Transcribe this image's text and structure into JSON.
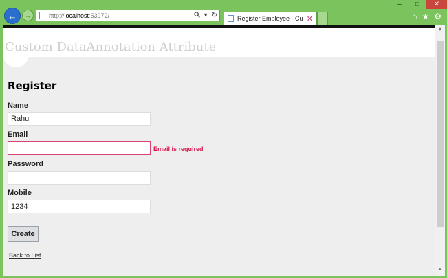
{
  "window": {
    "controls": [
      "–",
      "□",
      "✕"
    ]
  },
  "browser": {
    "url_prefix": "http://",
    "url_host": "localhost",
    "url_rest": ":53972/",
    "address_icons": [
      "search-icon",
      "dropdown-icon",
      "refresh-icon"
    ],
    "tab_title": "Register Employee - Custo...",
    "tab_close": "✕",
    "toolbar_icons": [
      "home-icon",
      "favorites-icon",
      "settings-icon"
    ]
  },
  "site": {
    "title": "Custom DataAnnotation Attribute"
  },
  "form": {
    "heading": "Register",
    "fields": [
      {
        "label": "Name",
        "value": "Rahul",
        "error": ""
      },
      {
        "label": "Email",
        "value": "",
        "error": "Email is required"
      },
      {
        "label": "Password",
        "value": "",
        "error": ""
      },
      {
        "label": "Mobile",
        "value": "1234",
        "error": ""
      }
    ],
    "submit_label": "Create",
    "back_link": "Back to List"
  }
}
